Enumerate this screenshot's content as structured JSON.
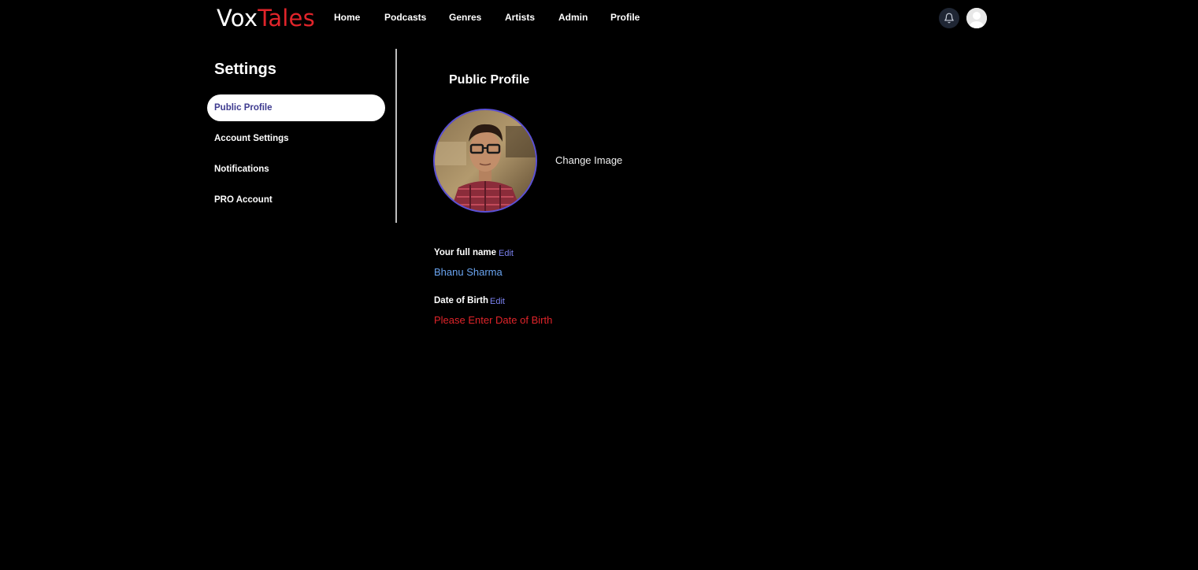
{
  "brand": {
    "logo_part1": "Vox",
    "logo_part2": "Tales",
    "primary_color": "#ffffff",
    "accent_color": "#e0242a"
  },
  "nav": {
    "items": [
      {
        "label": "Home"
      },
      {
        "label": "Podcasts"
      },
      {
        "label": "Genres"
      },
      {
        "label": "Artists"
      },
      {
        "label": "Admin"
      },
      {
        "label": "Profile"
      }
    ],
    "icons": {
      "notifications": "bell-icon",
      "user": "user-avatar-icon"
    }
  },
  "sidebar": {
    "title": "Settings",
    "items": [
      {
        "label": "Public Profile",
        "active": true
      },
      {
        "label": "Account Settings",
        "active": false
      },
      {
        "label": "Notifications",
        "active": false
      },
      {
        "label": "PRO Account",
        "active": false
      }
    ]
  },
  "main": {
    "section_title": "Public Profile",
    "change_image_label": "Change Image",
    "fields": [
      {
        "label": "Your full name",
        "edit_label": "Edit",
        "value": "Bhanu Sharma",
        "value_color": "#6aa4f0"
      },
      {
        "label": "Date of Birth",
        "edit_label": "Edit",
        "value": "Please Enter Date of Birth",
        "value_color": "#e0242a"
      }
    ]
  }
}
